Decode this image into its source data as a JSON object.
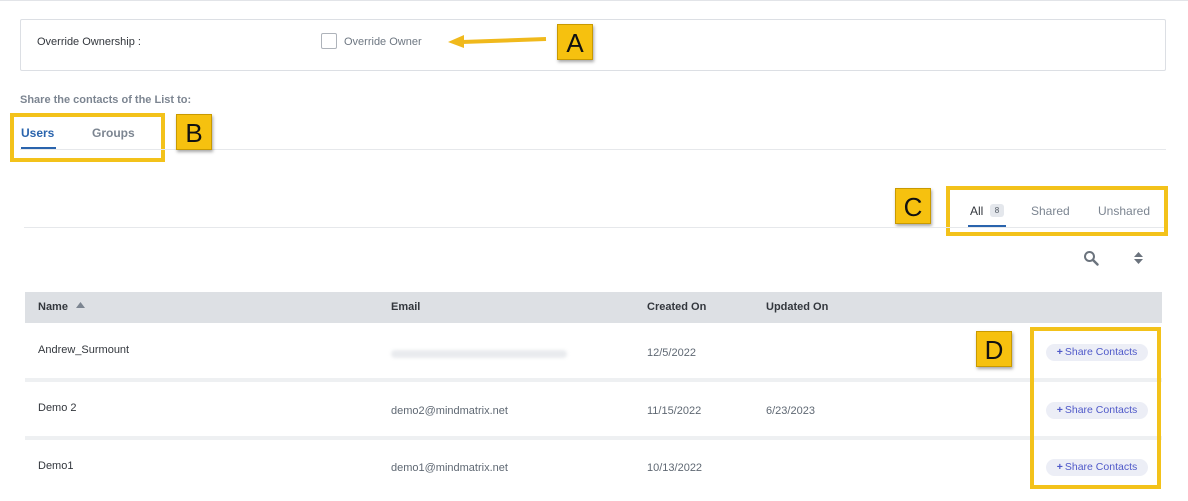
{
  "override": {
    "label": "Override Ownership :",
    "checkbox_label": "Override Owner",
    "checked": false
  },
  "share_section": {
    "title": "Share the contacts of the List to:",
    "tabs": [
      {
        "label": "Users",
        "active": true
      },
      {
        "label": "Groups",
        "active": false
      }
    ]
  },
  "filters": {
    "all_label": "All",
    "all_count": "8",
    "shared_label": "Shared",
    "unshared_label": "Unshared",
    "active": "All"
  },
  "toolbar": {
    "search_icon": "search-icon",
    "sort_icon": "sort-icon"
  },
  "table": {
    "columns": [
      "Name",
      "Email",
      "Created On",
      "Updated On"
    ],
    "sort_column": "Name",
    "rows": [
      {
        "name": "Andrew_Surmount",
        "email": "",
        "created": "12/5/2022",
        "updated": "",
        "action": "Share Contacts"
      },
      {
        "name": "Demo 2",
        "email": "demo2@mindmatrix.net",
        "created": "11/15/2022",
        "updated": "6/23/2023",
        "action": "Share Contacts"
      },
      {
        "name": "Demo1",
        "email": "demo1@mindmatrix.net",
        "created": "10/13/2022",
        "updated": "",
        "action": "Share Contacts"
      }
    ]
  },
  "callouts": [
    "A",
    "B",
    "C",
    "D"
  ],
  "colors": {
    "accent": "#2a64ad",
    "callout": "#f6c10f",
    "share_button_text": "#4f59c9"
  }
}
